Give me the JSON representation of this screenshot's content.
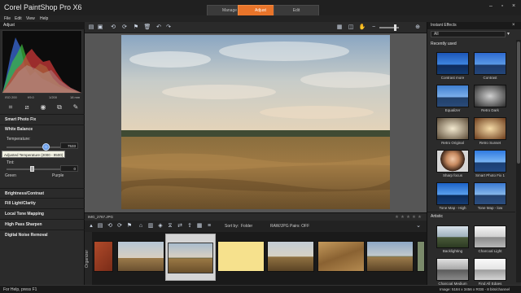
{
  "app": {
    "title": "Corel PaintShop Pro X6",
    "tabs": [
      "Manage",
      "Adjust",
      "Edit"
    ],
    "active_tab": "Adjust"
  },
  "menu": [
    "File",
    "Edit",
    "View",
    "Help"
  ],
  "left_panel": {
    "header": "Adjust",
    "histogram_stats": [
      "ISO 200",
      "f/9.0",
      "1/200",
      "18 mm"
    ],
    "smart_photo_fix": "Smart Photo Fix",
    "white_balance": "White Balance",
    "temperature_label": "Temperature:",
    "temperature_value": "7533",
    "tint_label": "Tint:",
    "tint_value": "0",
    "green_label": "Green",
    "purple_label": "Purple",
    "tooltip": "Adjusted Temperature (2000 - 9500)",
    "groups": [
      "Brightness/Contrast",
      "Fill Light/Clarity",
      "Local Tone Mapping",
      "High Pass Sharpen",
      "Digital Noise Removal"
    ]
  },
  "toolbar_icons": [
    "save-icon",
    "save-as-icon",
    "compare-icon",
    "compare-icon",
    "delete-icon",
    "undo-icon",
    "redo-icon"
  ],
  "organizer": {
    "filename": "IMG_2767.JPG",
    "sort_label": "Sort by:",
    "folder_label": "Folder",
    "raw_jpg_label": "RAW/JPG Pairs: OFF",
    "side_label": "Organizer"
  },
  "right_panel": {
    "header": "Instant Effects",
    "category_selected": "All",
    "recently_used": "Recently used",
    "artistic": "Artistic",
    "recent_effects": [
      "Contrast more",
      "Contrast",
      "Equalizer",
      "Retro Dark",
      "Retro Original",
      "Retro Sunset",
      "Sharp focus",
      "Smart Photo Fix 1",
      "Tone Map - High",
      "Tone Map - low"
    ],
    "artistic_effects": [
      "Backlighting",
      "Charcoal Light",
      "Charcoal Medium",
      "Find All Edges"
    ]
  },
  "status": {
    "left": "For Help, press F1",
    "right": "Image: 5184 x 3456 x RGB - 8 bits/channel"
  },
  "colors": {
    "accent": "#e8742a",
    "panel": "#2b2b2b",
    "canvas": "#565656"
  }
}
